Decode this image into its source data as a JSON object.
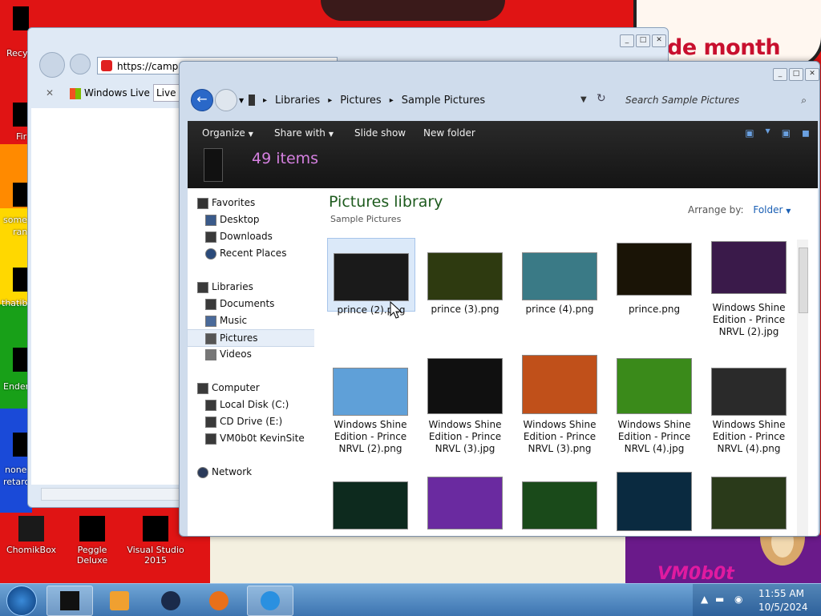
{
  "desktop": {
    "banner_text": "de month",
    "watermark": "VM0b0t",
    "icons": [
      {
        "label": "Recy"
      },
      {
        "label": "Fir"
      },
      {
        "label": "some"
      },
      {
        "label": "ran"
      },
      {
        "label": "thatib"
      },
      {
        "label": "Ender"
      },
      {
        "label": "none"
      },
      {
        "label": "retarc"
      }
    ],
    "bottom_icons": [
      {
        "label": "ChomikBox"
      },
      {
        "label": "Peggle Deluxe"
      },
      {
        "label": "Visual Studio 2015"
      }
    ]
  },
  "browser": {
    "url": "https://campai",
    "tab_label": "Windows Live",
    "tab_input": "Live S"
  },
  "explorer": {
    "breadcrumb": [
      "Libraries",
      "Pictures",
      "Sample Pictures"
    ],
    "search_placeholder": "Search Sample Pictures",
    "commands": {
      "organize": "Organize",
      "share_with": "Share with",
      "slide_show": "Slide show",
      "new_folder": "New folder"
    },
    "items_count": "49 items",
    "nav": {
      "favorites": "Favorites",
      "desktop": "Desktop",
      "downloads": "Downloads",
      "recent_places": "Recent Places",
      "libraries": "Libraries",
      "documents": "Documents",
      "music": "Music",
      "pictures": "Pictures",
      "videos": "Videos",
      "computer": "Computer",
      "local_disk": "Local Disk (C:)",
      "cd_drive": "CD Drive (E:)",
      "vm_site": "VM0b0t KevinSite",
      "network": "Network"
    },
    "library_title": "Pictures library",
    "library_subtitle": "Sample Pictures",
    "arrange_label": "Arrange by:",
    "arrange_value": "Folder",
    "files": [
      {
        "name": "prince (2).png",
        "color": "#1a1a1a"
      },
      {
        "name": "prince (3).png",
        "color": "#2e3a10"
      },
      {
        "name": "prince (4).png",
        "color": "#3a7a86"
      },
      {
        "name": "prince.png",
        "color": "#1a1406"
      },
      {
        "name": "Windows Shine Edition - Prince NRVL (2).jpg",
        "color": "#3a1a4a"
      },
      {
        "name": "Windows Shine Edition - Prince NRVL (2).png",
        "color": "#5fa0d8"
      },
      {
        "name": "Windows Shine Edition - Prince NRVL (3).jpg",
        "color": "#101010"
      },
      {
        "name": "Windows Shine Edition - Prince NRVL (3).png",
        "color": "#c0501a"
      },
      {
        "name": "Windows Shine Edition - Prince NRVL (4).jpg",
        "color": "#3a8a1a"
      },
      {
        "name": "Windows Shine Edition - Prince NRVL (4).png",
        "color": "#2a2a2a"
      }
    ],
    "partial_row_colors": [
      "#0d2a1e",
      "#6a2aa0",
      "#1a4a1a",
      "#0a2a40",
      "#2a3a1a"
    ]
  },
  "taskbar": {
    "time": "11:55 AM",
    "date": "10/5/2024"
  }
}
